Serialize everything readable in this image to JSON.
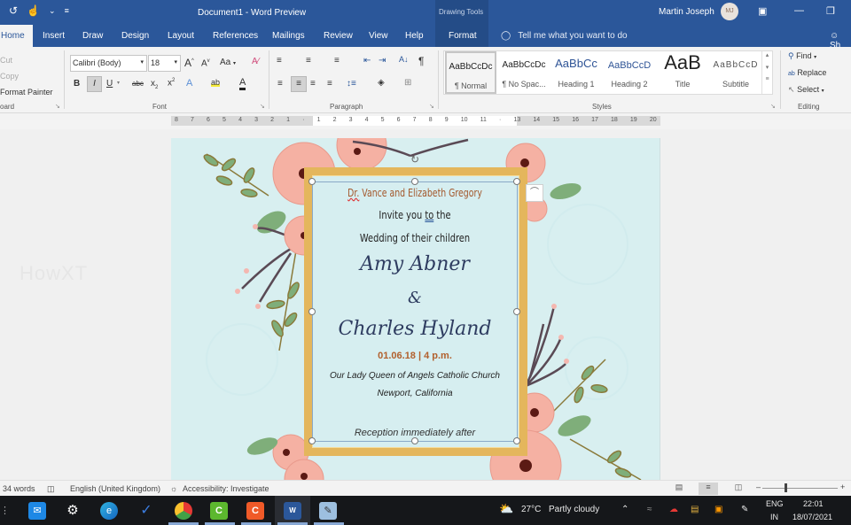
{
  "window": {
    "title": "Document1  -  Word Preview",
    "contextual_group": "Drawing Tools",
    "user_name": "Martin Joseph",
    "user_initials": "MJ",
    "qat_icons": [
      "undo-icon",
      "touch-mode-icon",
      "customize-qat-icon"
    ]
  },
  "tabs": [
    {
      "label": "Home",
      "active": true
    },
    {
      "label": "Insert"
    },
    {
      "label": "Draw"
    },
    {
      "label": "Design"
    },
    {
      "label": "Layout"
    },
    {
      "label": "References"
    },
    {
      "label": "Mailings"
    },
    {
      "label": "Review"
    },
    {
      "label": "View"
    },
    {
      "label": "Help"
    },
    {
      "label": "Format",
      "contextual": true
    }
  ],
  "tell_me": "Tell me what you want to do",
  "share_label": "Sh",
  "ribbon": {
    "clipboard": {
      "cut": "Cut",
      "copy": "Copy",
      "format_painter": "Format Painter",
      "group": "oard"
    },
    "font": {
      "name": "Calibri (Body)",
      "size": "18",
      "group": "Font",
      "change_case": "Aa"
    },
    "paragraph": {
      "group": "Paragraph"
    },
    "styles": {
      "group": "Styles",
      "items": [
        {
          "preview": "AaBbCcDc",
          "name": "¶ Normal",
          "active": true
        },
        {
          "preview": "AaBbCcDc",
          "name": "¶ No Spac..."
        },
        {
          "preview": "AaBbCc",
          "name": "Heading 1"
        },
        {
          "preview": "AaBbCcD",
          "name": "Heading 2"
        },
        {
          "preview": "AaB",
          "name": "Title"
        },
        {
          "preview": "AaBbCcD",
          "name": "Subtitle"
        }
      ]
    },
    "editing": {
      "group": "Editing",
      "find": "Find",
      "replace": "Replace",
      "select": "Select"
    }
  },
  "ruler": {
    "labels": [
      "8",
      "7",
      "6",
      "5",
      "4",
      "3",
      "2",
      "1",
      "",
      "1",
      "2",
      "3",
      "4",
      "5",
      "6",
      "7",
      "8",
      "9",
      "10",
      "11",
      "",
      "13",
      "14",
      "15",
      "16",
      "17",
      "18",
      "19",
      "20"
    ]
  },
  "watermark": "HowXT",
  "invitation": {
    "hosts_prefix": "Dr.",
    "hosts_rest": " Vance and Elizabeth Gregory",
    "invite_a": "Invite you ",
    "invite_to": "to",
    "invite_b": " the",
    "wedding": "Wedding of their children",
    "bride": "Amy Abner",
    "amp": "&",
    "groom": "Charles Hyland",
    "date": "01.06.18 | 4 p.m.",
    "church": "Our Lady Queen of Angels Catholic Church",
    "city": "Newport, California",
    "reception": "Reception immediately after"
  },
  "status": {
    "words": "34 words",
    "language": "English (United Kingdom)",
    "accessibility": "Accessibility: Investigate"
  },
  "taskbar": {
    "weather_temp": "27°C",
    "weather_text": "Partly cloudy",
    "lang_top": "ENG",
    "lang_bottom": "IN",
    "time": "22:01",
    "date": "18/07/2021",
    "apps": [
      "mail-icon",
      "settings-icon",
      "edge-icon",
      "todo-icon",
      "chrome-icon",
      "camtasia-icon",
      "camtasia-rec-icon",
      "word-icon",
      "notepad-icon"
    ]
  },
  "colors": {
    "accent": "#2b579a",
    "frame_gold": "#e4b65c",
    "host_text": "#a3572b",
    "name_text": "#2e3c60"
  }
}
